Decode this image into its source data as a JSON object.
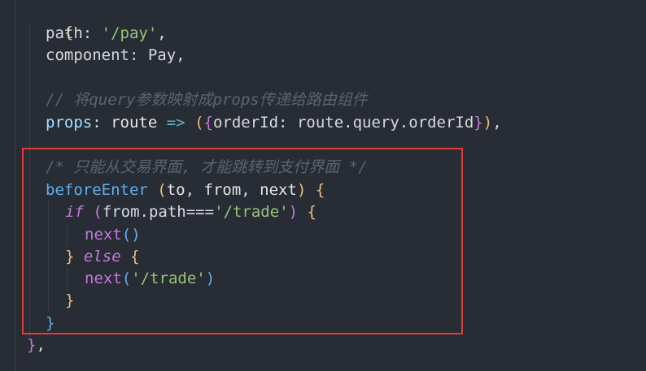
{
  "editor": {
    "theme_colors": {
      "background": "#282c34",
      "highlight_border": "#e23b3b",
      "keyword": "#c678dd",
      "function": "#61afef",
      "string": "#98c379",
      "comment": "#5c6370",
      "bracket_level1": "#e5c07b",
      "bracket_level2": "#c678dd"
    },
    "lines": {
      "l1_brace": "{",
      "l2_key": "path",
      "l2_colon": ": ",
      "l2_value": "'/pay'",
      "l2_comma": ",",
      "l3_key": "component",
      "l3_colon": ": ",
      "l3_value": "Pay",
      "l3_comma": ",",
      "l5_comment": "// 将query参数映射成props传递给路由组件",
      "l6_key": "props",
      "l6_colon": ": ",
      "l6_param": "route",
      "l6_arrow": " => ",
      "l6_paren_open": "(",
      "l6_brace_open": "{",
      "l6_obj_key": "orderId",
      "l6_obj_colon": ": ",
      "l6_obj_value": "route.query.orderId",
      "l6_brace_close": "}",
      "l6_paren_close": ")",
      "l6_comma": ",",
      "l8_comment": "/* 只能从交易界面, 才能跳转到支付界面 */",
      "l9_fn": "beforeEnter",
      "l9_paren_open": " (",
      "l9_p1": "to",
      "l9_sep1": ", ",
      "l9_p2": "from",
      "l9_sep2": ", ",
      "l9_p3": "next",
      "l9_paren_close": ")",
      "l9_brace": " {",
      "l10_if": "if",
      "l10_paren_open": " (",
      "l10_expr": "from.path===",
      "l10_str": "'/trade'",
      "l10_paren_close": ")",
      "l10_brace": " {",
      "l11_call": "next",
      "l11_parens": "()",
      "l12_brace_close": "}",
      "l12_else": " else",
      "l12_brace_open": " {",
      "l13_call": "next",
      "l13_paren_open": "(",
      "l13_str": "'/trade'",
      "l13_paren_close": ")",
      "l14_brace_close": "}",
      "l15_brace_close": "}",
      "l16_brace_close": "}",
      "l16_comma": ","
    }
  }
}
